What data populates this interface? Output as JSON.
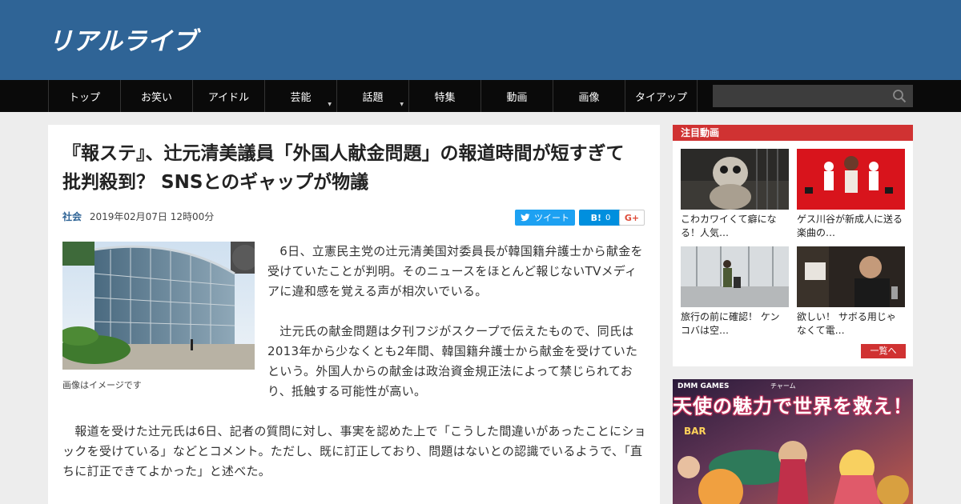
{
  "site": {
    "logo_text": "リアルライブ"
  },
  "nav": {
    "items": [
      {
        "label": "トップ"
      },
      {
        "label": "お笑い"
      },
      {
        "label": "アイドル"
      },
      {
        "label": "芸能",
        "has_submenu": true
      },
      {
        "label": "話題",
        "has_submenu": true
      },
      {
        "label": "特集"
      },
      {
        "label": "動画"
      },
      {
        "label": "画像"
      },
      {
        "label": "タイアップ"
      }
    ],
    "search_placeholder": ""
  },
  "article": {
    "title": "『報ステ』、辻元清美議員「外国人献金問題」の報道時間が短すぎて批判殺到？ SNSとのギャップが物議",
    "category": "社会",
    "date": "2019年02月07日 12時00分",
    "share": {
      "tweet_label": "ツイート",
      "hatena_label": "B!",
      "hatena_count": "0",
      "gplus_label": "G+"
    },
    "image_caption": "画像はイメージです",
    "paragraphs": [
      "　6日、立憲民主党の辻元清美国対委員長が韓国籍弁護士から献金を受けていたことが判明。そのニュースをほとんど報じないTVメディアに違和感を覚える声が相次いでいる。",
      "　辻元氏の献金問題は夕刊フジがスクープで伝えたもので、同氏は2013年から少なくとも2年間、韓国籍弁護士から献金を受けていたという。外国人からの献金は政治資金規正法によって禁じられており、抵触する可能性が高い。",
      "　報道を受けた辻元氏は6日、記者の質問に対し、事実を認めた上で「こうした間違いがあったことにショックを受けている」などとコメント。ただし、既に訂正しており、問題はないとの認識でいるようで、「直ちに訂正できてよかった」と述べた。"
    ]
  },
  "sidebar": {
    "heading": "注目動画",
    "videos": [
      {
        "title": "こわカワイくて癖になる！人気…"
      },
      {
        "title": "ゲス川谷が新成人に送る楽曲の…"
      },
      {
        "title": "旅行の前に確認！ ケンコバは空…"
      },
      {
        "title": "欲しい！ サボる用じゃなくて電…"
      }
    ],
    "more_label": "一覧へ"
  },
  "ad": {
    "brand": "DMM GAMES",
    "ruby": "チャーム",
    "headline": "天使の魅力で世界を救え！",
    "sign": "BAR"
  },
  "colors": {
    "header_bg": "#2f6496",
    "nav_bg": "#0a0a0a",
    "accent_red": "#d03232",
    "tweet_blue": "#1da1f2",
    "hatena_blue": "#008fde"
  }
}
